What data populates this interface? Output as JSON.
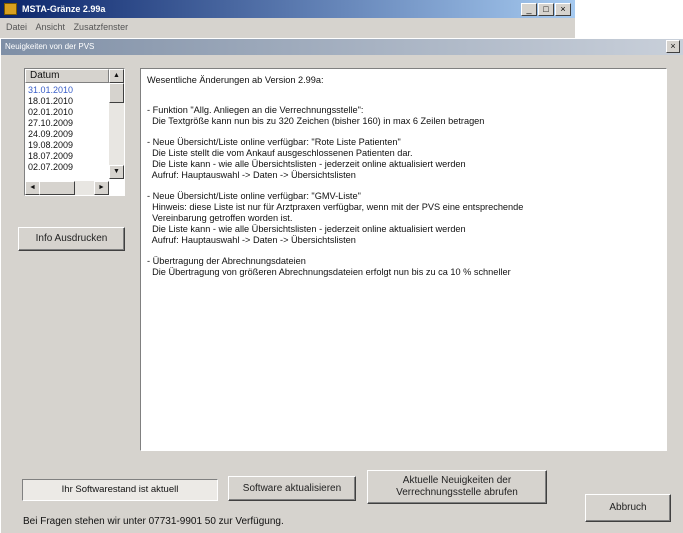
{
  "background_window": {
    "title": "MSTA-Gränze 2.99a",
    "menu": [
      "Datei",
      "Ansicht",
      "Zusatzfenster"
    ]
  },
  "dialog": {
    "title": "Neuigkeiten von der PVS",
    "close_label": "×",
    "date_list": {
      "header": "Datum",
      "items": [
        "31.01.2010",
        "18.01.2010",
        "02.01.2010",
        "27.10.2009",
        "24.09.2009",
        "19.08.2009",
        "18.07.2009",
        "02.07.2009"
      ],
      "selected": "31.01.2010"
    },
    "print_button": "Info Ausdrucken",
    "content": {
      "heading": "Wesentliche Änderungen ab Version 2.99a:",
      "sections": [
        [
          "- Funktion \"Allg. Anliegen an die Verrechnungsstelle\":",
          "  Die Textgröße kann nun bis zu 320 Zeichen (bisher 160) in max 6 Zeilen betragen"
        ],
        [
          "- Neue Übersicht/Liste online verfügbar: \"Rote Liste Patienten\"",
          "  Die Liste stellt die vom Ankauf ausgeschlossenen Patienten dar.",
          "  Die Liste kann - wie alle Übersichtslisten - jederzeit online aktualisiert werden",
          "  Aufruf: Hauptauswahl -> Daten -> Übersichtslisten"
        ],
        [
          "- Neue Übersicht/Liste online verfügbar: \"GMV-Liste\"",
          "  Hinweis: diese Liste ist nur für Arztpraxen verfügbar, wenn mit der PVS eine entsprechende",
          "  Vereinbarung getroffen worden ist.",
          "  Die Liste kann - wie alle Übersichtslisten - jederzeit online aktualisiert werden",
          "  Aufruf: Hauptauswahl -> Daten -> Übersichtslisten"
        ],
        [
          "- Übertragung der Abrechnungsdateien",
          "  Die Übertragung von größeren Abrechnungsdateien erfolgt nun bis zu ca 10 % schneller"
        ]
      ]
    },
    "status_text": "Ihr Softwarestand  ist aktuell",
    "update_button": "Software aktualisieren",
    "news_button": [
      "Aktuelle Neuigkeiten der",
      "Verrechnungsstelle abrufen"
    ],
    "cancel_button": "Abbruch",
    "contact_text": "Bei Fragen stehen wir unter 07731-9901 50 zur Verfügung."
  }
}
